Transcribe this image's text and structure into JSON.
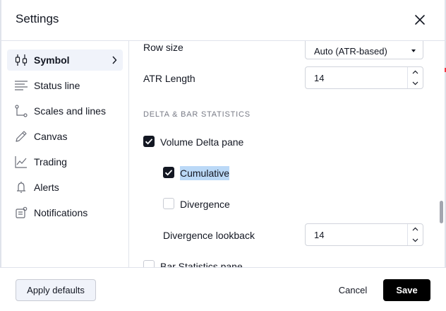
{
  "header": {
    "title": "Settings",
    "close_icon": "close-icon"
  },
  "sidebar": {
    "items": [
      {
        "label": "Symbol",
        "icon": "candlestick-icon",
        "active": true
      },
      {
        "label": "Status line",
        "icon": "status-line-icon"
      },
      {
        "label": "Scales and lines",
        "icon": "scales-icon"
      },
      {
        "label": "Canvas",
        "icon": "pencil-icon"
      },
      {
        "label": "Trading",
        "icon": "trading-chart-icon"
      },
      {
        "label": "Alerts",
        "icon": "alarm-clock-icon"
      },
      {
        "label": "Notifications",
        "icon": "notifications-icon"
      }
    ]
  },
  "content": {
    "row_size": {
      "label": "Row size",
      "value": "Auto (ATR-based)"
    },
    "atr_length": {
      "label": "ATR Length",
      "value": "14"
    },
    "section_title": "DELTA & BAR STATISTICS",
    "volume_delta_pane": {
      "label": "Volume Delta pane",
      "checked": true
    },
    "cumulative": {
      "label": "Cumulative",
      "checked": true
    },
    "divergence": {
      "label": "Divergence",
      "checked": false
    },
    "divergence_lookback": {
      "label": "Divergence lookback",
      "value": "14"
    },
    "bar_statistics_pane": {
      "label": "Bar Statistics pane",
      "checked": false
    }
  },
  "footer": {
    "apply_defaults": "Apply defaults",
    "cancel": "Cancel",
    "save": "Save"
  },
  "colors": {
    "accent": "#131722",
    "save_button": "#000000",
    "selection_highlight": "#bbd9f7",
    "active_nav": "#f0f3fa"
  }
}
